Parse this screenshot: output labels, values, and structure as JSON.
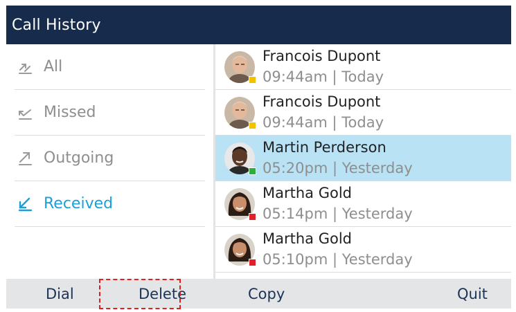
{
  "title": "Call History",
  "filters": [
    {
      "label": "All",
      "icon": "all-calls-icon",
      "active": false
    },
    {
      "label": "Missed",
      "icon": "missed-call-icon",
      "active": false
    },
    {
      "label": "Outgoing",
      "icon": "outgoing-call-icon",
      "active": false
    },
    {
      "label": "Received",
      "icon": "received-call-icon",
      "active": true
    }
  ],
  "calls": [
    {
      "name": "Francois Dupont",
      "time": "09:44am | Today",
      "status_color": "#f2c200",
      "avatar": "older-man-avatar",
      "selected": false
    },
    {
      "name": "Francois Dupont",
      "time": "09:44am | Today",
      "status_color": "#f2c200",
      "avatar": "older-man-avatar",
      "selected": false
    },
    {
      "name": "Martin Perderson",
      "time": "05:20pm | Yesterday",
      "status_color": "#2fae3a",
      "avatar": "man-avatar",
      "selected": true
    },
    {
      "name": "Martha Gold",
      "time": "05:14pm | Yesterday",
      "status_color": "#e0202a",
      "avatar": "woman-avatar",
      "selected": false
    },
    {
      "name": "Martha Gold",
      "time": "05:10pm | Yesterday",
      "status_color": "#e0202a",
      "avatar": "woman-avatar",
      "selected": false
    }
  ],
  "softkeys": {
    "dial": "Dial",
    "delete": "Delete",
    "copy": "Copy",
    "quit": "Quit"
  },
  "colors": {
    "titlebar": "#172b4d",
    "accent": "#1aa0d8",
    "selected_row": "#b9e2f4",
    "softkey_bar": "#e4e5e7",
    "highlight_box": "#e02020"
  }
}
